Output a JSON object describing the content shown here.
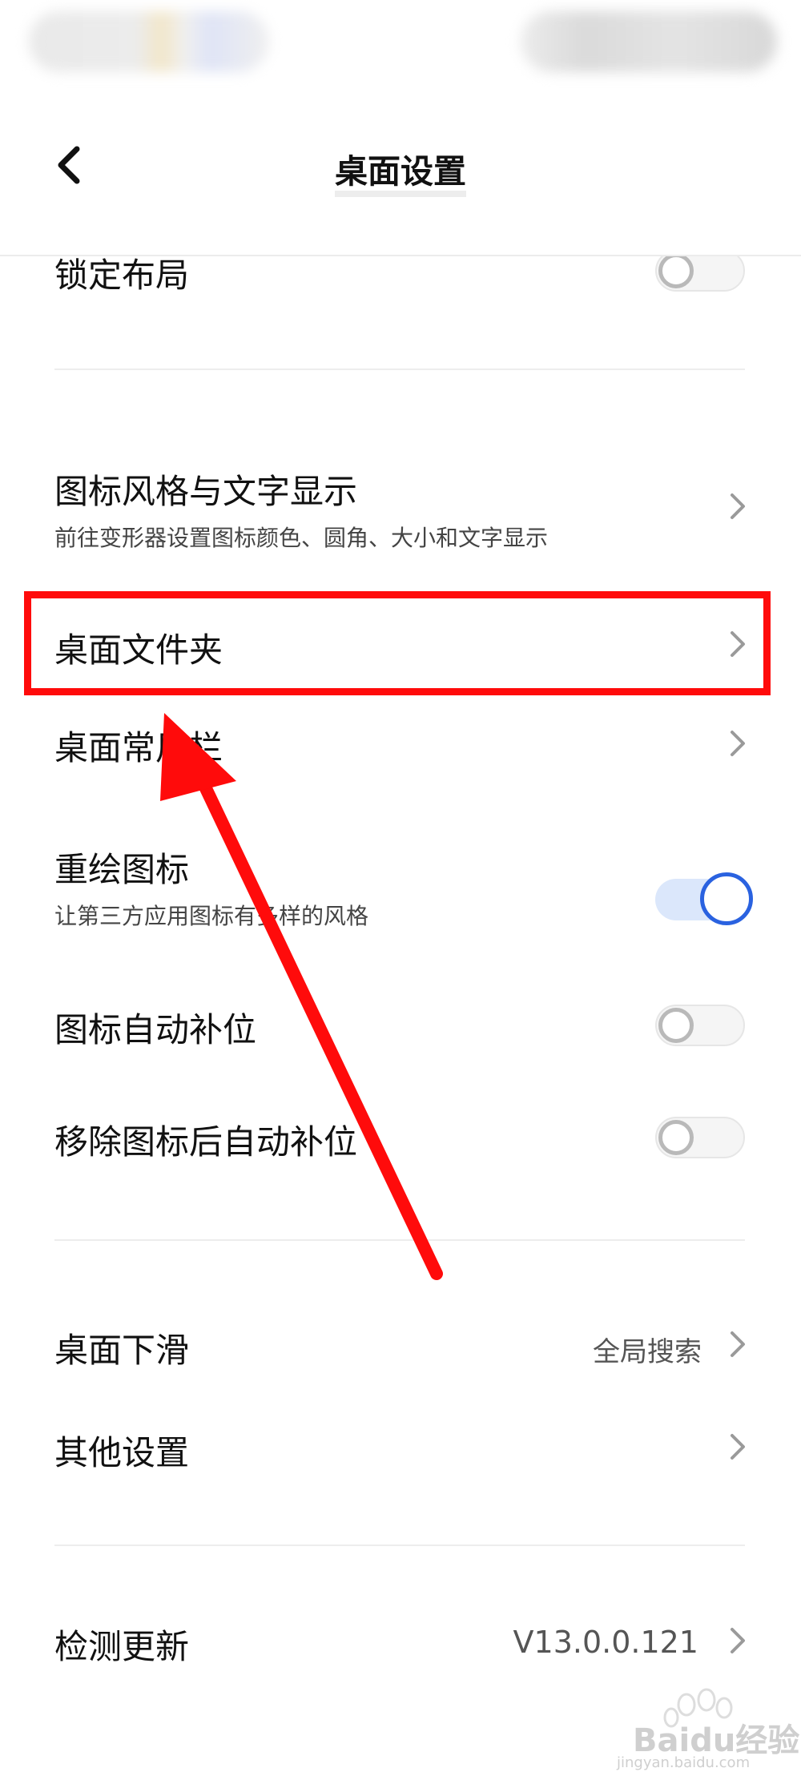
{
  "header": {
    "title": "桌面设置"
  },
  "settings": {
    "lock_layout": {
      "label": "锁定布局",
      "enabled": false
    },
    "icon_style": {
      "label": "图标风格与文字显示",
      "subtitle": "前往变形器设置图标颜色、圆角、大小和文字显示"
    },
    "desktop_folder": {
      "label": "桌面文件夹"
    },
    "desktop_dock": {
      "label": "桌面常用栏"
    },
    "redraw_icons": {
      "label": "重绘图标",
      "subtitle": "让第三方应用图标有多样的风格",
      "enabled": true
    },
    "icon_auto_fill": {
      "label": "图标自动补位",
      "enabled": false
    },
    "remove_auto_fill": {
      "label": "移除图标后自动补位",
      "enabled": false
    },
    "desktop_swipe_down": {
      "label": "桌面下滑",
      "value": "全局搜索"
    },
    "other_settings": {
      "label": "其他设置"
    },
    "check_update": {
      "label": "检测更新",
      "value": "V13.0.0.121"
    }
  },
  "watermark": {
    "text": "Baidu经验",
    "url": "jingyan.baidu.com"
  },
  "colors": {
    "accent": "#2a62e0",
    "annotation": "#ff0b0b",
    "toggle_on_track": "#dbe7fb"
  }
}
